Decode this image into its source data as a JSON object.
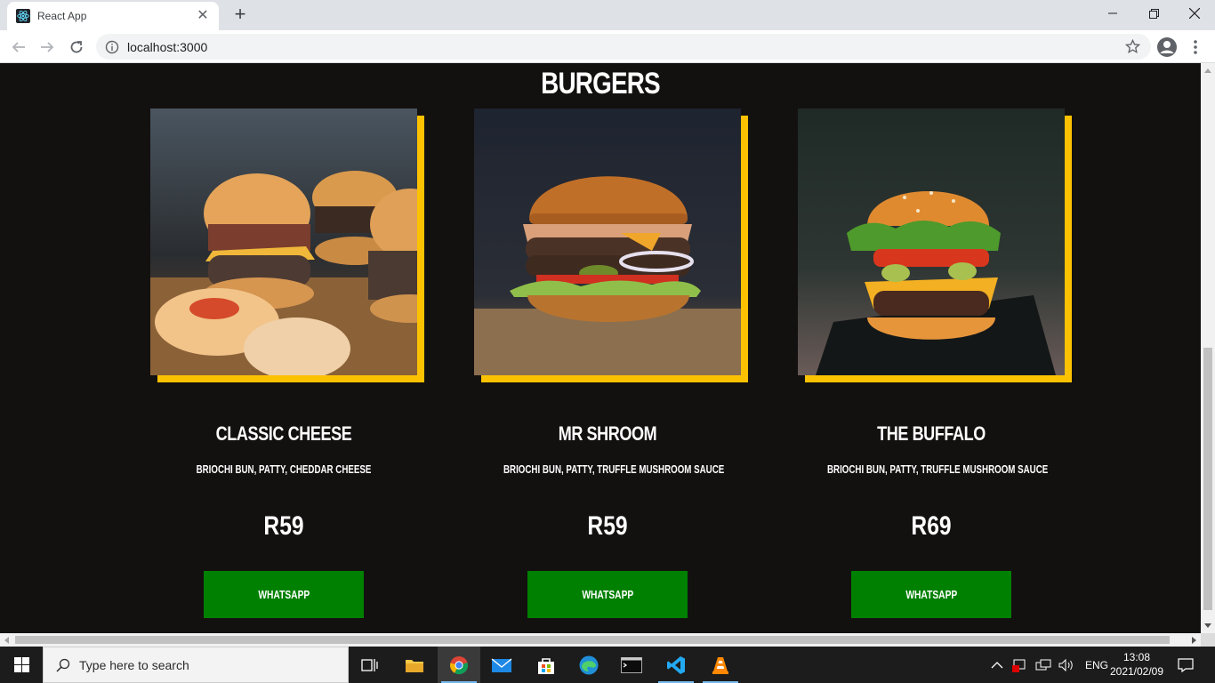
{
  "browser": {
    "tab_title": "React App",
    "url": "localhost:3000"
  },
  "page": {
    "section_title": "BURGERS",
    "items": [
      {
        "name": "CLASSIC CHEESE",
        "description": "BRIOCHI BUN, PATTY, CHEDDAR CHEESE",
        "price": "R59",
        "button_label": "WHATSAPP"
      },
      {
        "name": "MR SHROOM",
        "description": "BRIOCHI BUN, PATTY, TRUFFLE MUSHROOM SAUCE",
        "price": "R59",
        "button_label": "WHATSAPP"
      },
      {
        "name": "THE BUFFALO",
        "description": "BRIOCHI BUN, PATTY, TRUFFLE MUSHROOM SAUCE",
        "price": "R69",
        "button_label": "WHATSAPP"
      }
    ]
  },
  "taskbar": {
    "search_placeholder": "Type here to search",
    "language": "ENG",
    "time": "13:08",
    "date": "2021/02/09"
  },
  "colors": {
    "page_background": "#131010",
    "accent_frame": "#fcc201",
    "whatsapp_button": "#008000"
  }
}
